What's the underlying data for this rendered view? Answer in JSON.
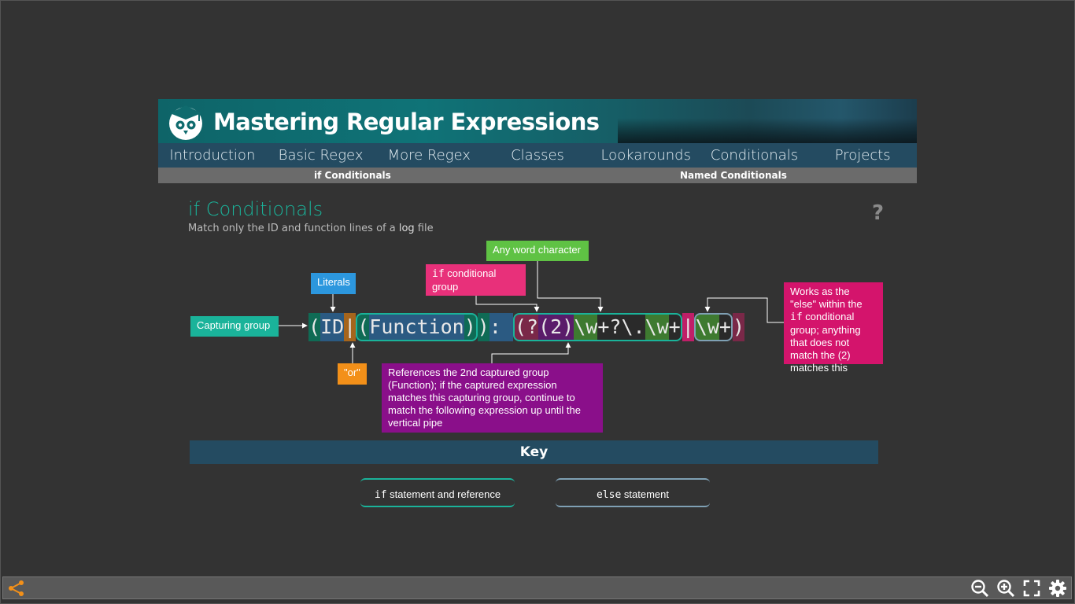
{
  "header": {
    "title": "Mastering Regular Expressions"
  },
  "nav": [
    "Introduction",
    "Basic Regex",
    "More Regex",
    "Classes",
    "Lookarounds",
    "Conditionals",
    "Projects"
  ],
  "subnav": [
    "if Conditionals",
    "Named Conditionals"
  ],
  "page": {
    "title": "if Conditionals",
    "subtitle_pre": "Match only the ID and function lines of a ",
    "subtitle_bold": "log",
    "subtitle_post": " file",
    "help": "?"
  },
  "labels": {
    "capturing_group": "Capturing group",
    "literals": "Literals",
    "or": "\"or\"",
    "any_word": "Any word character",
    "if_group_code": "if",
    "if_group_text": " conditional group",
    "else_pre": "Works as the \"else\" within the ",
    "else_code": "if",
    "else_post": " conditional group; anything that does not match the (2) matches this",
    "references": "References the 2nd captured group (Function); if the captured expression matches this capturing group, continue to match the following expression up until the vertical pipe"
  },
  "regex": [
    "(",
    "ID",
    "|",
    "(",
    "Function",
    ")",
    ")",
    ":",
    " ",
    "(?",
    "(2)",
    "\\w",
    "+?\\.",
    "\\w",
    "+",
    "|",
    "\\w",
    "+",
    ")"
  ],
  "key": {
    "title": "Key",
    "if_code": "if",
    "if_text": " statement and reference",
    "else_code": "else",
    "else_text": " statement"
  },
  "colors": {
    "teal": "#1ab39a",
    "green": "#5fc244",
    "pink": "#e8307a",
    "magenta": "#d4146c",
    "purple": "#8a0f8a",
    "orange": "#f39019",
    "blue": "#2c97de",
    "nav": "#244b61"
  },
  "toolbar": [
    "share-icon",
    "zoom-out-icon",
    "zoom-in-icon",
    "fullscreen-icon",
    "settings-icon"
  ]
}
